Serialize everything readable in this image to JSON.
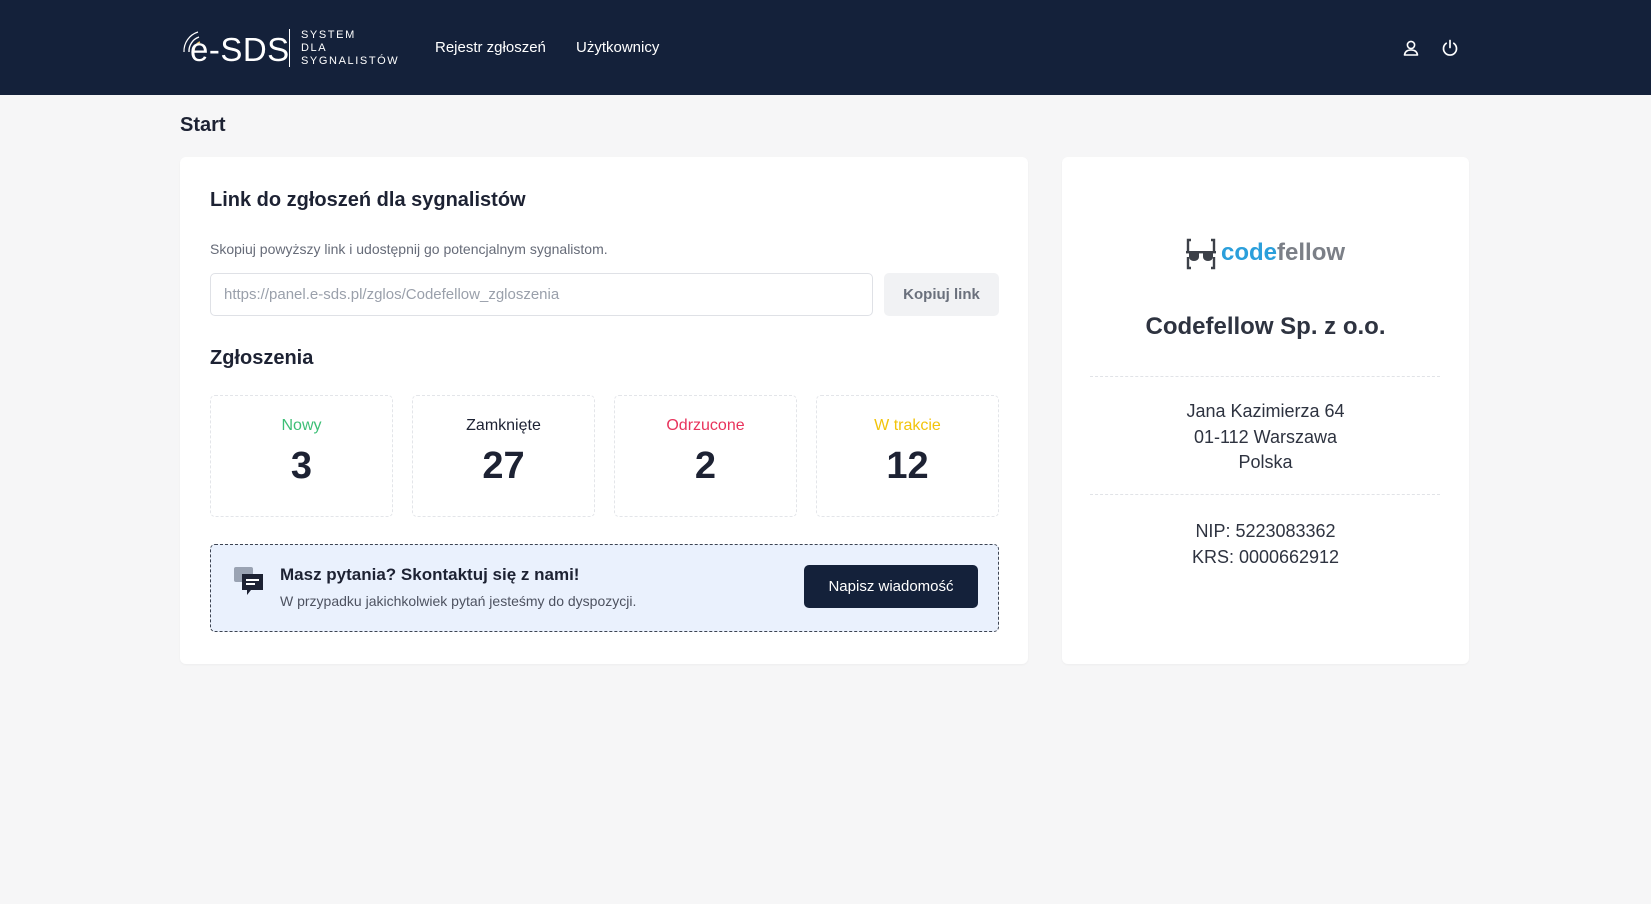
{
  "header": {
    "logo_main": "e-SDS",
    "logo_sub": [
      "SYSTEM",
      "DLA",
      "SYGNALISTÓW"
    ],
    "nav": [
      {
        "label": "Rejestr zgłoszeń"
      },
      {
        "label": "Użytkownicy"
      }
    ],
    "icons": [
      "user-icon",
      "power-icon"
    ]
  },
  "page": {
    "title": "Start"
  },
  "link_section": {
    "title": "Link do zgłoszeń dla sygnalistów",
    "description": "Skopiuj powyższy link i udostępnij go potencjalnym sygnalistom.",
    "url": "https://panel.e-sds.pl/zglos/Codefellow_zgloszenia",
    "copy_label": "Kopiuj link"
  },
  "reports": {
    "title": "Zgłoszenia",
    "stats": [
      {
        "label": "Nowy",
        "value": "3",
        "color": "#3dbf76"
      },
      {
        "label": "Zamknięte",
        "value": "27",
        "color": "#1d2233"
      },
      {
        "label": "Odrzucone",
        "value": "2",
        "color": "#e8335c"
      },
      {
        "label": "W trakcie",
        "value": "12",
        "color": "#f2c40c"
      }
    ]
  },
  "contact": {
    "title": "Masz pytania? Skontaktuj się z nami!",
    "subtitle": "W przypadku jakichkolwiek pytań jesteśmy do dyspozycji.",
    "button": "Napisz wiadomość",
    "icon": "chat-icon"
  },
  "company": {
    "logo_code": "code",
    "logo_fellow": "fellow",
    "name": "Codefellow Sp. z o.o.",
    "address": [
      "Jana Kazimierza 64",
      "01-112 Warszawa",
      "Polska"
    ],
    "nip": "NIP: 5223083362",
    "krs": "KRS: 0000662912"
  },
  "colors": {
    "topbar": "#14213a",
    "background": "#f6f6f7",
    "accent": "#2b9fdb"
  }
}
